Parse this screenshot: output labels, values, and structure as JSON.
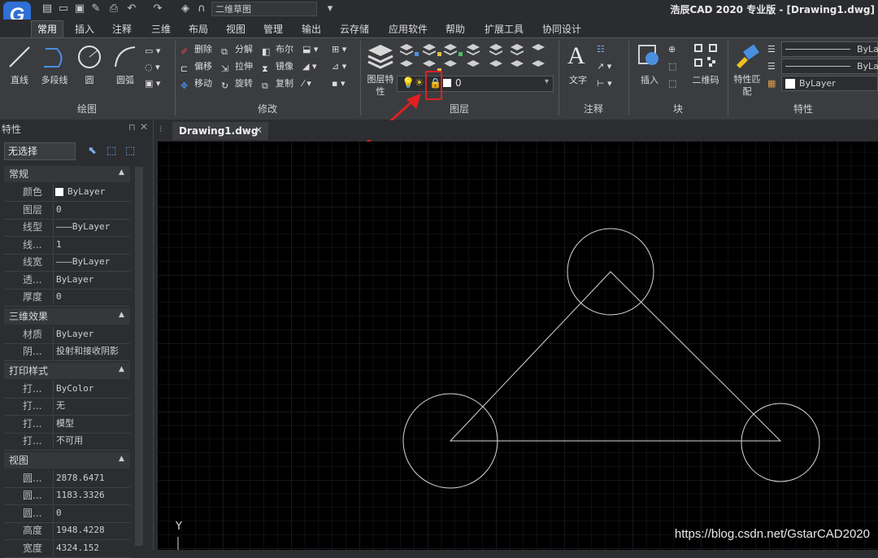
{
  "app": {
    "logo_letter": "G",
    "title": "浩辰CAD 2020 专业版 - [Drawing1.dwg]",
    "workspace": "二维草图"
  },
  "ribbon_tabs": [
    "常用",
    "插入",
    "注释",
    "三维",
    "布局",
    "视图",
    "管理",
    "输出",
    "云存储",
    "应用软件",
    "帮助",
    "扩展工具",
    "协同设计"
  ],
  "panels": {
    "draw": {
      "title": "绘图",
      "buttons": [
        "直线",
        "多段线",
        "圆",
        "圆弧"
      ]
    },
    "modify": {
      "title": "修改",
      "commands": [
        "删除",
        "分解",
        "布尔",
        "偏移",
        "拉伸",
        "镜像",
        "移动",
        "旋转",
        "复制"
      ]
    },
    "layers": {
      "title": "图层",
      "props_label": "图层特性",
      "current_layer": "0"
    },
    "annotation": {
      "title": "注释",
      "text_label": "文字"
    },
    "block": {
      "title": "块",
      "insert_label": "插入",
      "qrcode_label": "二维码"
    },
    "properties": {
      "title": "特性",
      "match_label": "特性匹配",
      "linetype1": "ByLayer",
      "linetype2": "ByLayer",
      "color": "ByLayer"
    }
  },
  "palette": {
    "title": "特性",
    "selection": "无选择",
    "sections": [
      {
        "name": "常规",
        "rows": [
          {
            "key": "颜色",
            "value": "ByLayer"
          },
          {
            "key": "图层",
            "value": "0"
          },
          {
            "key": "线型",
            "value": "———ByLayer"
          },
          {
            "key": "线...",
            "value": "1"
          },
          {
            "key": "线宽",
            "value": "———ByLayer"
          },
          {
            "key": "透...",
            "value": "ByLayer"
          },
          {
            "key": "厚度",
            "value": "0"
          }
        ]
      },
      {
        "name": "三维效果",
        "rows": [
          {
            "key": "材质",
            "value": "ByLayer"
          },
          {
            "key": "阴...",
            "value": "投射和接收阴影"
          }
        ]
      },
      {
        "name": "打印样式",
        "rows": [
          {
            "key": "打...",
            "value": "ByColor"
          },
          {
            "key": "打...",
            "value": "无"
          },
          {
            "key": "打...",
            "value": "模型"
          },
          {
            "key": "打...",
            "value": "不可用"
          }
        ]
      },
      {
        "name": "视图",
        "rows": [
          {
            "key": "圆...",
            "value": "2878.6471"
          },
          {
            "key": "圆...",
            "value": "1183.3326"
          },
          {
            "key": "圆...",
            "value": "0"
          },
          {
            "key": "高度",
            "value": "1948.4228"
          },
          {
            "key": "宽度",
            "value": "4324.152"
          }
        ]
      }
    ]
  },
  "document": {
    "tab": "Drawing1.dwg",
    "ucs_y": "Y"
  },
  "watermark": "https://blog.csdn.net/GstarCAD2020",
  "colors": {
    "accent": "#2f6fd6",
    "highlight": "#e02020",
    "canvas": "#000000"
  }
}
